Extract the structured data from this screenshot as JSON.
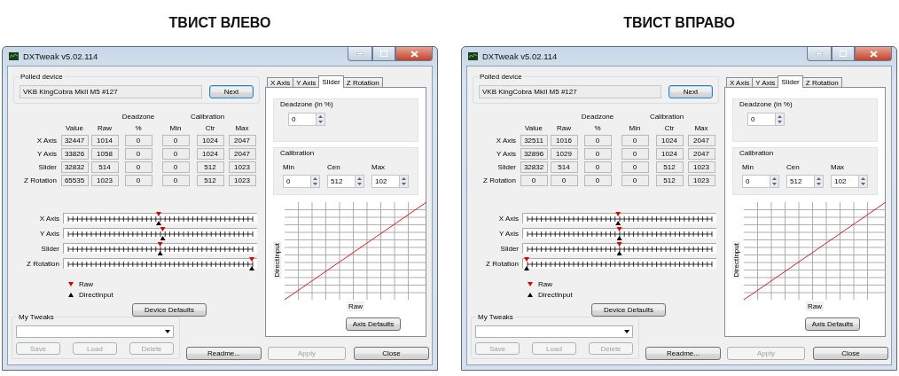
{
  "panels": [
    {
      "heading": "ТВИСТ ВЛЕВО",
      "window": {
        "title": "DXTweak v5.02.114",
        "polled_device": {
          "label": "Polled device",
          "value": "VKB KingCobra MkII M5 #127",
          "button": "Next"
        },
        "table": {
          "deadzone_header": "Deadzone",
          "calibration_header": "Calibration",
          "columns": [
            "Value",
            "Raw",
            "%",
            "Min",
            "Ctr",
            "Max"
          ],
          "rows": [
            {
              "label": "X Axis",
              "cells": [
                "32447",
                "1014",
                "0",
                "0",
                "1024",
                "2047"
              ]
            },
            {
              "label": "Y Axis",
              "cells": [
                "33826",
                "1058",
                "0",
                "0",
                "1024",
                "2047"
              ]
            },
            {
              "label": "Slider",
              "cells": [
                "32832",
                "514",
                "0",
                "0",
                "512",
                "1023"
              ]
            },
            {
              "label": "Z Rotation",
              "cells": [
                "65535",
                "1023",
                "0",
                "0",
                "512",
                "1023"
              ]
            }
          ]
        },
        "bars": [
          {
            "label": "X Axis",
            "raw": {
              "level": 0.495
            },
            "directinput": {
              "level": 0.495
            }
          },
          {
            "label": "Y Axis",
            "raw": {
              "level": 0.517
            },
            "directinput": {
              "level": 0.517
            }
          },
          {
            "label": "Slider",
            "raw": {
              "level": 0.503
            },
            "directinput": {
              "level": 0.503
            }
          },
          {
            "label": "Z Rotation",
            "raw": {
              "level": 1
            },
            "directinput": {
              "level": 1
            }
          }
        ],
        "legend": [
          {
            "kind": "raw",
            "label": "Raw"
          },
          {
            "kind": "directinput",
            "label": "DirectInput"
          }
        ],
        "device_defaults": "Device Defaults",
        "my_tweaks": {
          "label": "My Tweaks",
          "buttons": [
            {
              "label": "Save",
              "disabled": true
            },
            {
              "label": "Load",
              "disabled": true
            },
            {
              "label": "Delete",
              "disabled": true
            }
          ]
        },
        "buttons": [
          {
            "label": "Readme...",
            "disabled": false
          },
          {
            "label": "Apply",
            "disabled": true
          },
          {
            "label": "Close",
            "disabled": false
          }
        ],
        "tabs": [
          {
            "label": "X Axis",
            "selected": false
          },
          {
            "label": "Y Axis",
            "selected": false
          },
          {
            "label": "Slider",
            "selected": true
          },
          {
            "label": "Z Rotation",
            "selected": false
          }
        ],
        "deadzone": {
          "label": "Deadzone (in %)",
          "value": "0"
        },
        "calibration": {
          "label": "Calibration",
          "fields": [
            {
              "label": "Min",
              "value": "0"
            },
            {
              "label": "Cen",
              "value": "512"
            },
            {
              "label": "Max",
              "value": "102"
            }
          ]
        },
        "graph": {
          "ylabel": "DirectInput",
          "xlabel": "Raw"
        },
        "axis_defaults": "Axis Defaults"
      }
    },
    {
      "heading": "ТВИСТ ВПРАВО",
      "window": {
        "title": "DXTweak v5.02.114",
        "polled_device": {
          "label": "Polled device",
          "value": "VKB KingCobra MkII M5 #127",
          "button": "Next"
        },
        "table": {
          "deadzone_header": "Deadzone",
          "calibration_header": "Calibration",
          "columns": [
            "Value",
            "Raw",
            "%",
            "Min",
            "Ctr",
            "Max"
          ],
          "rows": [
            {
              "label": "X Axis",
              "cells": [
                "32511",
                "1016",
                "0",
                "0",
                "1024",
                "2047"
              ]
            },
            {
              "label": "Y Axis",
              "cells": [
                "32896",
                "1029",
                "0",
                "0",
                "1024",
                "2047"
              ]
            },
            {
              "label": "Slider",
              "cells": [
                "32832",
                "514",
                "0",
                "0",
                "512",
                "1023"
              ]
            },
            {
              "label": "Z Rotation",
              "cells": [
                "0",
                "0",
                "0",
                "0",
                "512",
                "1023"
              ]
            }
          ]
        },
        "bars": [
          {
            "label": "X Axis",
            "raw": {
              "level": 0.496
            },
            "directinput": {
              "level": 0.496
            }
          },
          {
            "label": "Y Axis",
            "raw": {
              "level": 0.503
            },
            "directinput": {
              "level": 0.503
            }
          },
          {
            "label": "Slider",
            "raw": {
              "level": 0.503
            },
            "directinput": {
              "level": 0.503
            }
          },
          {
            "label": "Z Rotation",
            "raw": {
              "level": 0
            },
            "directinput": {
              "level": 0
            }
          }
        ],
        "legend": [
          {
            "kind": "raw",
            "label": "Raw"
          },
          {
            "kind": "directinput",
            "label": "DirectInput"
          }
        ],
        "device_defaults": "Device Defaults",
        "my_tweaks": {
          "label": "My Tweaks",
          "buttons": [
            {
              "label": "Save",
              "disabled": true
            },
            {
              "label": "Load",
              "disabled": true
            },
            {
              "label": "Delete",
              "disabled": true
            }
          ]
        },
        "buttons": [
          {
            "label": "Readme...",
            "disabled": false
          },
          {
            "label": "Apply",
            "disabled": true
          },
          {
            "label": "Close",
            "disabled": false
          }
        ],
        "tabs": [
          {
            "label": "X Axis",
            "selected": false
          },
          {
            "label": "Y Axis",
            "selected": false
          },
          {
            "label": "Slider",
            "selected": true
          },
          {
            "label": "Z Rotation",
            "selected": false
          }
        ],
        "deadzone": {
          "label": "Deadzone (in %)",
          "value": "0"
        },
        "calibration": {
          "label": "Calibration",
          "fields": [
            {
              "label": "Min",
              "value": "0"
            },
            {
              "label": "Cen",
              "value": "512"
            },
            {
              "label": "Max",
              "value": "102"
            }
          ]
        },
        "graph": {
          "ylabel": "DirectInput",
          "xlabel": "Raw"
        },
        "axis_defaults": "Axis Defaults"
      }
    }
  ]
}
